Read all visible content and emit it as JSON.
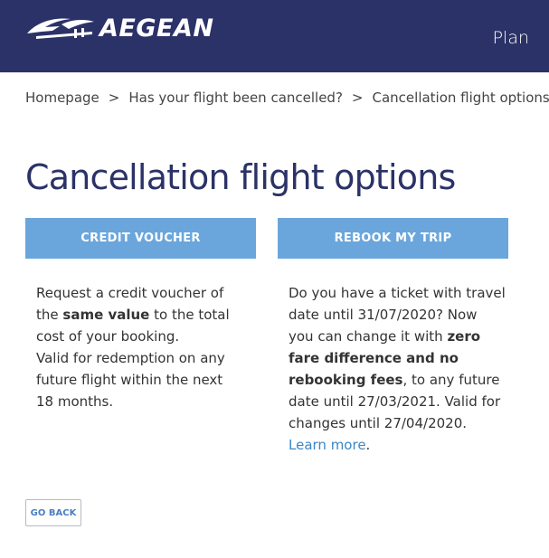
{
  "header": {
    "logo_text": "AEGEAN",
    "logo_icon": "aegean-bird-logo",
    "plan_label": "Plan",
    "background_color": "#2b3267"
  },
  "breadcrumb": {
    "items": [
      "Homepage",
      "Has your flight been cancelled?",
      "Cancellation flight options"
    ],
    "separator": ">"
  },
  "page_title": "Cancellation flight options",
  "options": {
    "credit": {
      "button_label": "CREDIT VOUCHER",
      "text_1": "Request a credit voucher of the ",
      "bold_1": "same value",
      "text_2": " to the total cost of your booking.",
      "text_3": "Valid for redemption on any future flight within the next 18 months."
    },
    "rebook": {
      "button_label": "REBOOK MY TRIP",
      "text_1": "Do you have a ticket with travel date until 31/07/2020? Now you can change it with ",
      "bold_1": "zero fare difference and no rebooking fees",
      "text_2": ", to any future date until 27/03/2021. Valid for changes until 27/04/2020. ",
      "link": "Learn more",
      "text_3": "."
    },
    "button_color": "#6aa6dc"
  },
  "go_back_label": "GO BACK",
  "colors": {
    "title": "#2b3267",
    "link": "#3d86c6"
  }
}
